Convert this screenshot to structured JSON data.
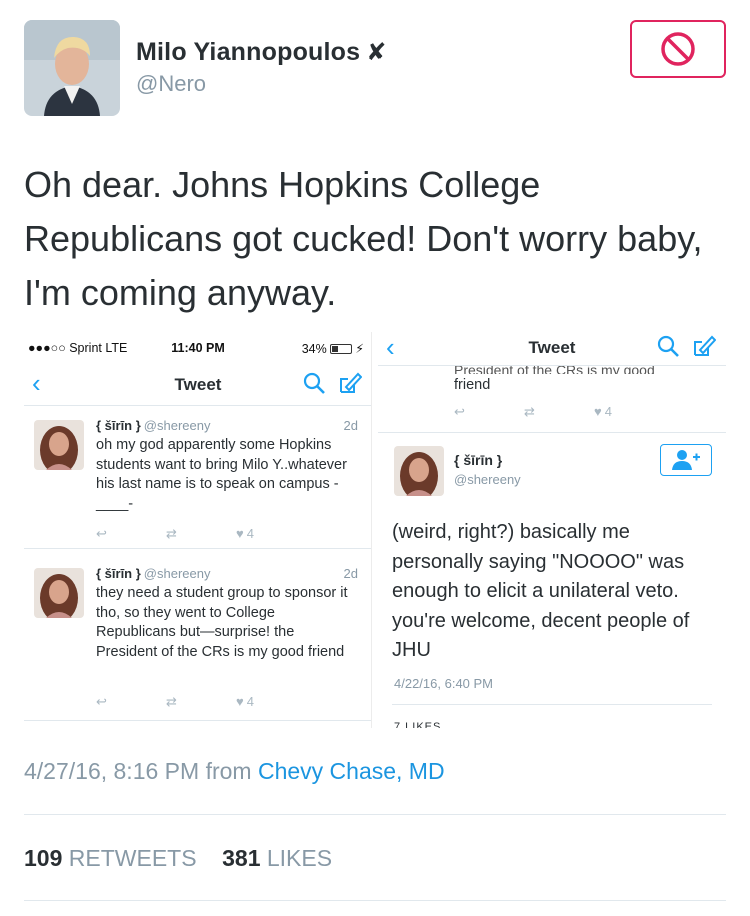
{
  "author": {
    "name": "Milo Yiannopoulos",
    "verified_mark": "✘",
    "handle": "@Nero"
  },
  "block_button": {
    "icon": "block-icon",
    "color": "#e0245e"
  },
  "tweet": {
    "text": "Oh dear. Johns Hopkins College Republicans got cucked! Don't worry baby, I'm coming anyway.",
    "timestamp": "4/27/16, 8:16 PM from ",
    "location": "Chevy Chase, MD",
    "retweets": "109",
    "retweets_label": "RETWEETS",
    "likes": "381",
    "likes_label": "LIKES"
  },
  "screenshot_left": {
    "status": {
      "carrier": "●●●○○ Sprint  LTE",
      "time": "11:40 PM",
      "battery": "34%"
    },
    "nav_title": "Tweet",
    "tweets": [
      {
        "name": "{ šīrīn }",
        "handle": "@shereeny",
        "time": "2d",
        "text": "oh my god apparently some Hopkins students want to bring Milo Y..whatever his last name is to speak on campus -____-",
        "likes": "4"
      },
      {
        "name": "{ šīrīn }",
        "handle": "@shereeny",
        "time": "2d",
        "text": "they need a student group to sponsor it tho, so they went to College Republicans but—surprise! the President of the CRs is my good friend",
        "likes": "4"
      }
    ]
  },
  "screenshot_right": {
    "nav_title": "Tweet",
    "cut_text": "President of the CRs is my good",
    "prev_text": "friend",
    "prev_likes": "4",
    "name": "{ šīrīn }",
    "handle": "@shereeny",
    "text": "(weird, right?) basically me personally saying \"NOOOO\" was enough to elicit a unilateral veto. you're welcome, decent people of JHU",
    "time": "4/22/16, 6:40 PM",
    "likes_cut": "7 LIKES"
  },
  "colors": {
    "accent": "#1da1f2",
    "link": "#1b95e0",
    "muted": "#8899a6",
    "block": "#e0245e"
  }
}
